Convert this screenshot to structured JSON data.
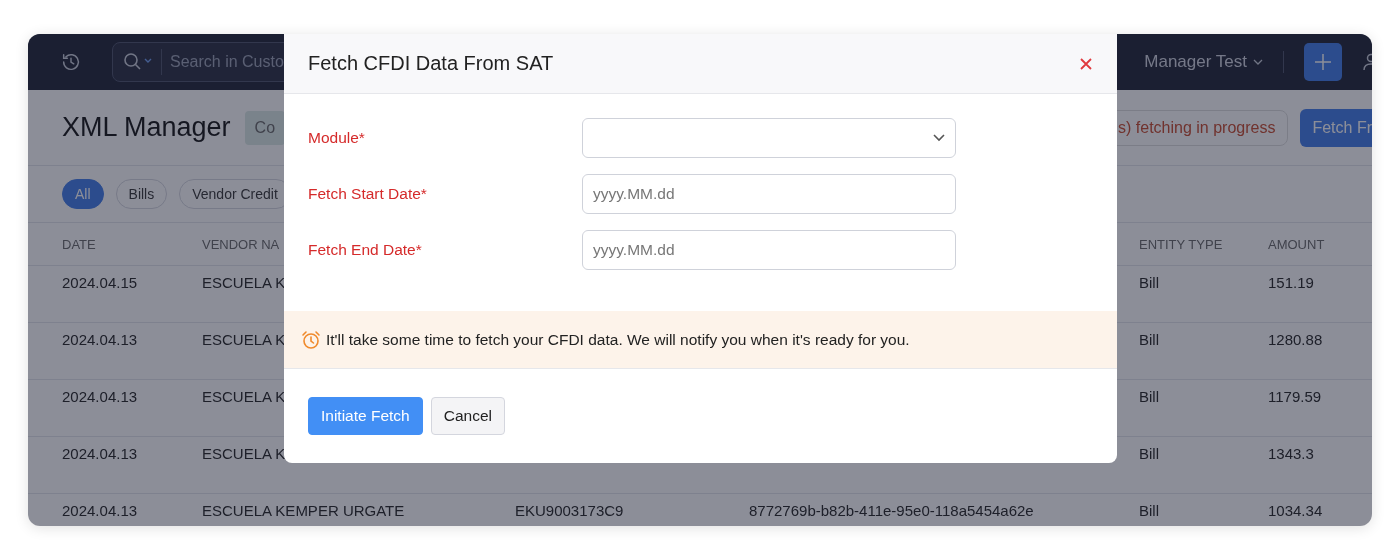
{
  "topbar": {
    "search": {
      "placeholder": "Search in Custo"
    },
    "org_name": "Manager Test"
  },
  "page": {
    "title": "XML Manager",
    "badge": "Co",
    "status": "s) fetching in progress",
    "fetch_button": "Fetch Fr"
  },
  "filters": [
    {
      "label": "All",
      "selected": true
    },
    {
      "label": "Bills",
      "selected": false
    },
    {
      "label": "Vendor Credit",
      "selected": false
    }
  ],
  "table": {
    "header": {
      "date": "DATE",
      "vendor": "VENDOR NA",
      "entity_type": "ENTITY TYPE",
      "amount": "AMOUNT"
    },
    "rows": [
      {
        "date": "2024.04.15",
        "vendor": "ESCUELA K",
        "entity_type": "Bill",
        "amount": "151.19"
      },
      {
        "date": "2024.04.13",
        "vendor": "ESCUELA K",
        "entity_type": "Bill",
        "amount": "1280.88"
      },
      {
        "date": "2024.04.13",
        "vendor": "ESCUELA K",
        "entity_type": "Bill",
        "amount": "1179.59"
      },
      {
        "date": "2024.04.13",
        "vendor": "ESCUELA K",
        "entity_type": "Bill",
        "amount": "1343.3"
      },
      {
        "date": "2024.04.13",
        "vendor": "ESCUELA KEMPER URGATE",
        "column_3": "EKU9003173C9",
        "column_4": "8772769b-b82b-411e-95e0-118a5454a62e",
        "entity_type": "Bill",
        "amount": "1034.34"
      }
    ]
  },
  "modal": {
    "title": "Fetch CFDI Data From SAT",
    "fields": [
      {
        "label": "Module*",
        "kind": "select"
      },
      {
        "label": "Fetch Start Date*",
        "kind": "date",
        "placeholder": "yyyy.MM.dd"
      },
      {
        "label": "Fetch End Date*",
        "kind": "date",
        "placeholder": "yyyy.MM.dd"
      }
    ],
    "notice": "It'll take some time to fetch your CFDI data. We will notify you when it's ready for you.",
    "buttons": [
      {
        "label": "Initiate Fetch",
        "kind": "primary"
      },
      {
        "label": "Cancel",
        "kind": "secondary"
      }
    ]
  }
}
